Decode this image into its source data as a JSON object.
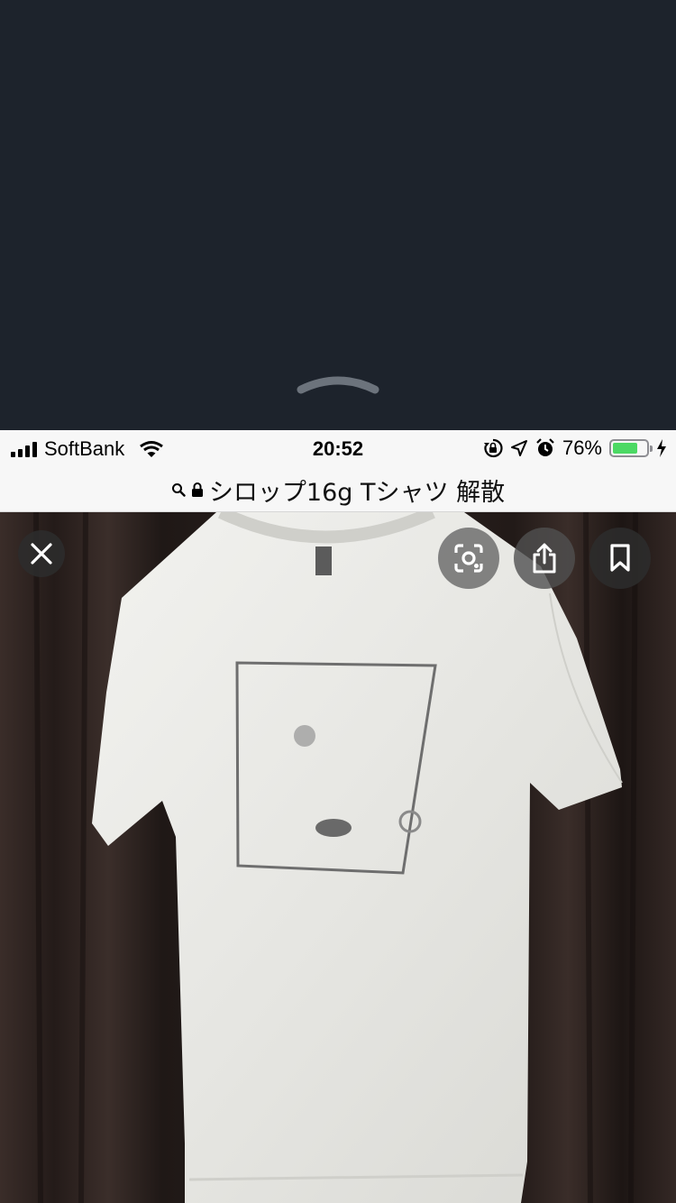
{
  "status_bar": {
    "carrier": "SoftBank",
    "time": "20:52",
    "battery_percent": "76%",
    "battery_level": 0.76,
    "battery_color": "#4cd964"
  },
  "url_bar": {
    "title": "シロップ16g Tシャツ 解散",
    "icons": [
      "search-icon",
      "lock-icon"
    ]
  },
  "image_viewer": {
    "photo_subject": "white t-shirt with square print on dark curtain",
    "buttons": [
      "close-icon",
      "google-lens-icon",
      "share-icon",
      "bookmark-icon"
    ]
  }
}
